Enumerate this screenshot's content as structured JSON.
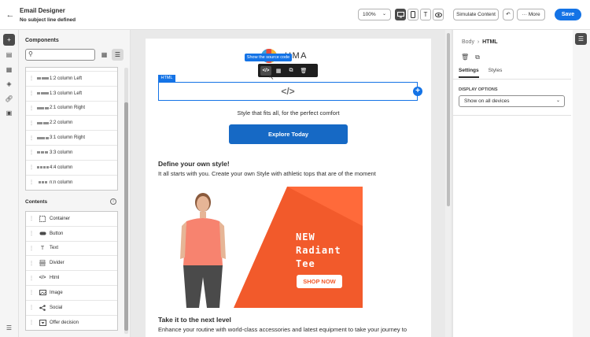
{
  "header": {
    "title": "Email Designer",
    "subtitle": "No subject line defined",
    "zoom": "100%",
    "simulate_label": "Simulate Content",
    "more_label": "More",
    "save_label": "Save"
  },
  "components": {
    "title": "Components",
    "search_placeholder": "",
    "structures": [
      "1:2 column Left",
      "1:3 column Left",
      "2:1 column Right",
      "2:2 column",
      "3:1 column Right",
      "3:3 column",
      "4:4 column",
      "n:n column"
    ]
  },
  "contents": {
    "title": "Contents",
    "items": [
      "Container",
      "Button",
      "Text",
      "Divider",
      "Html",
      "Image",
      "Social",
      "Offer decision"
    ]
  },
  "canvas": {
    "logo_text": "UMA",
    "tooltip": "Show the source code",
    "html_tag": "HTML",
    "html_placeholder": "</>",
    "tagline": "Style that fits all, for the perfect comfort",
    "cta": "Explore Today",
    "heading1": "Define your own style!",
    "paragraph1": "It all starts with you. Create your own Style with athletic tops that are of the moment",
    "banner": {
      "line1": "NEW",
      "line2": "Radiant",
      "line3": "Tee",
      "button": "SHOP NOW"
    },
    "heading2": "Take it to the next level",
    "paragraph2": "Enhance your routine with world-class accessories and latest equipment to take your journey to"
  },
  "properties": {
    "crumb_parent": "Body",
    "crumb_current": "HTML",
    "tabs": [
      "Settings",
      "Styles"
    ],
    "display_options_label": "DISPLAY OPTIONS",
    "display_value": "Show on all devices"
  },
  "colors": {
    "accent": "#1473e6",
    "cta": "#1669c5",
    "banner": "#f25a2b"
  }
}
